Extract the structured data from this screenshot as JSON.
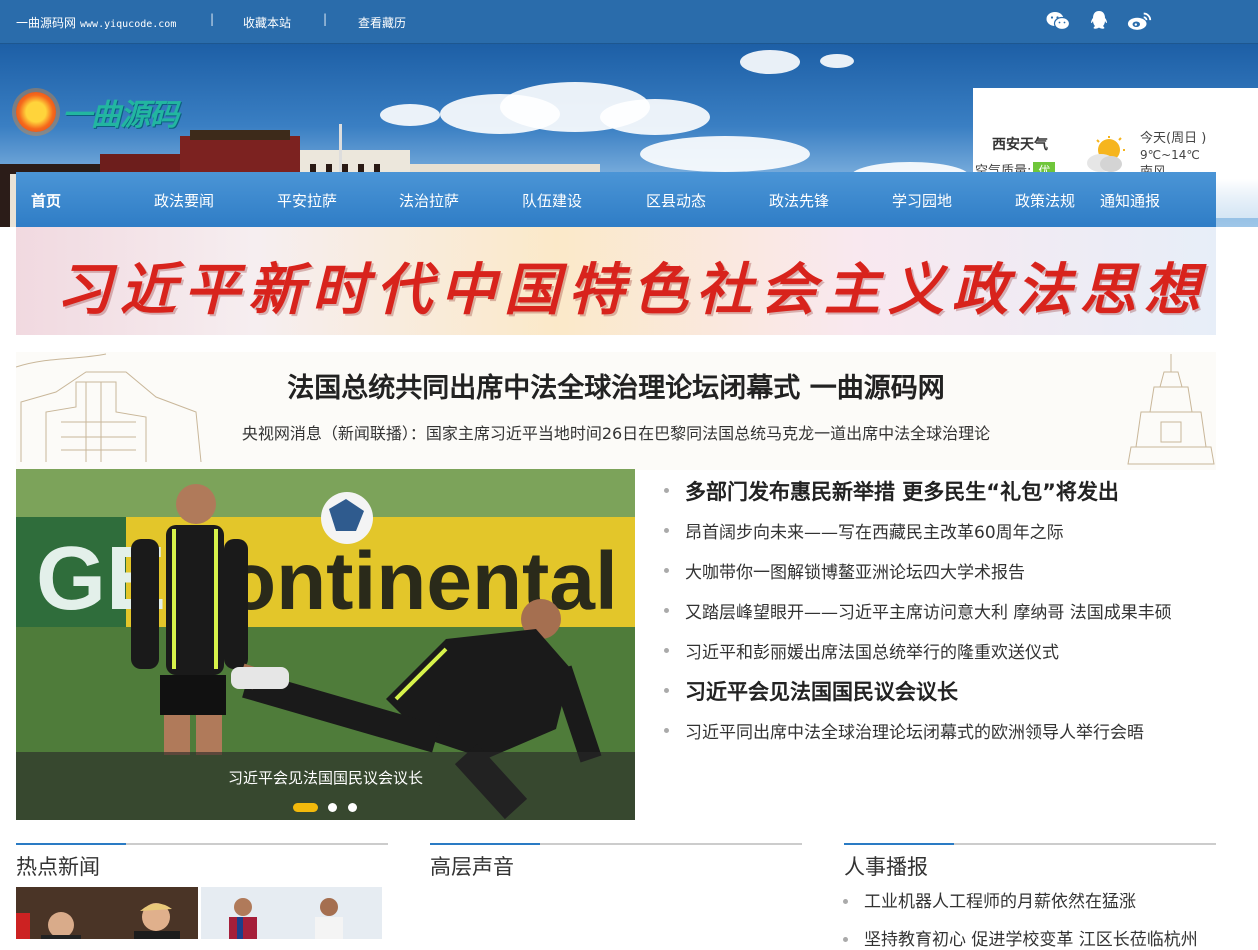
{
  "topbar": {
    "site_name": "一曲源码网",
    "site_url": "www.yiqucode.com",
    "sep": "|",
    "bookmark": "收藏本站",
    "history": "查看藏历"
  },
  "icons": {
    "wechat": "wechat-icon",
    "qq": "qq-icon",
    "weibo": "weibo-icon",
    "weather": "partly-cloudy-icon",
    "logo": "sun-logo-icon"
  },
  "logo": {
    "text": "一曲源码"
  },
  "weather": {
    "city": "西安天气",
    "aq_label": "空气质量:",
    "aq_value": "优",
    "today": "今天(周日 )",
    "temp": "9℃~14℃",
    "wind": "南风"
  },
  "nav": {
    "items": [
      "首页",
      "政法要闻",
      "平安拉萨",
      "法治拉萨",
      "队伍建设",
      "区县动态",
      "政法先锋",
      "学习园地",
      "政策法规",
      "通知通报"
    ]
  },
  "slogan": {
    "text": "习近平新时代中国特色社会主义政法思想"
  },
  "headline": {
    "title": "法国总统共同出席中法全球治理论坛闭幕式 一曲源码网",
    "summary": "央视网消息（新闻联播）：国家主席习近平当地时间26日在巴黎同法国总统马克龙一道出席中法全球治理论"
  },
  "slider": {
    "caption": "习近平会见法国国民议会议长",
    "active_index": 0,
    "dot_count": 3
  },
  "news": [
    {
      "title": "多部门发布惠民新举措 更多民生“礼包”将发出",
      "featured": true
    },
    {
      "title": "昂首阔步向未来——写在西藏民主改革60周年之际",
      "featured": false
    },
    {
      "title": "大咖带你一图解锁博鳌亚洲论坛四大学术报告",
      "featured": false
    },
    {
      "title": "又踏层峰望眼开——习近平主席访问意大利 摩纳哥 法国成果丰硕",
      "featured": false
    },
    {
      "title": "习近平和彭丽媛出席法国总统举行的隆重欢送仪式",
      "featured": false
    },
    {
      "title": "习近平会见法国国民议会议长",
      "featured": true
    },
    {
      "title": "习近平同出席中法全球治理论坛闭幕式的欧洲领导人举行会晤",
      "featured": false
    }
  ],
  "sections": {
    "hot": "热点新闻",
    "leaders": "高层声音",
    "personnel": "人事播报"
  },
  "personnel_news": [
    "工业机器人工程师的月薪依然在猛涨",
    "坚持教育初心 促进学校变革 江区长莅临杭州"
  ],
  "colors": {
    "topbar": "#2a6cab",
    "nav": "#3a87cc",
    "accent": "#2a7bc4",
    "slogan_red": "#d8231c",
    "slider_active_dot": "#f2b90c"
  }
}
